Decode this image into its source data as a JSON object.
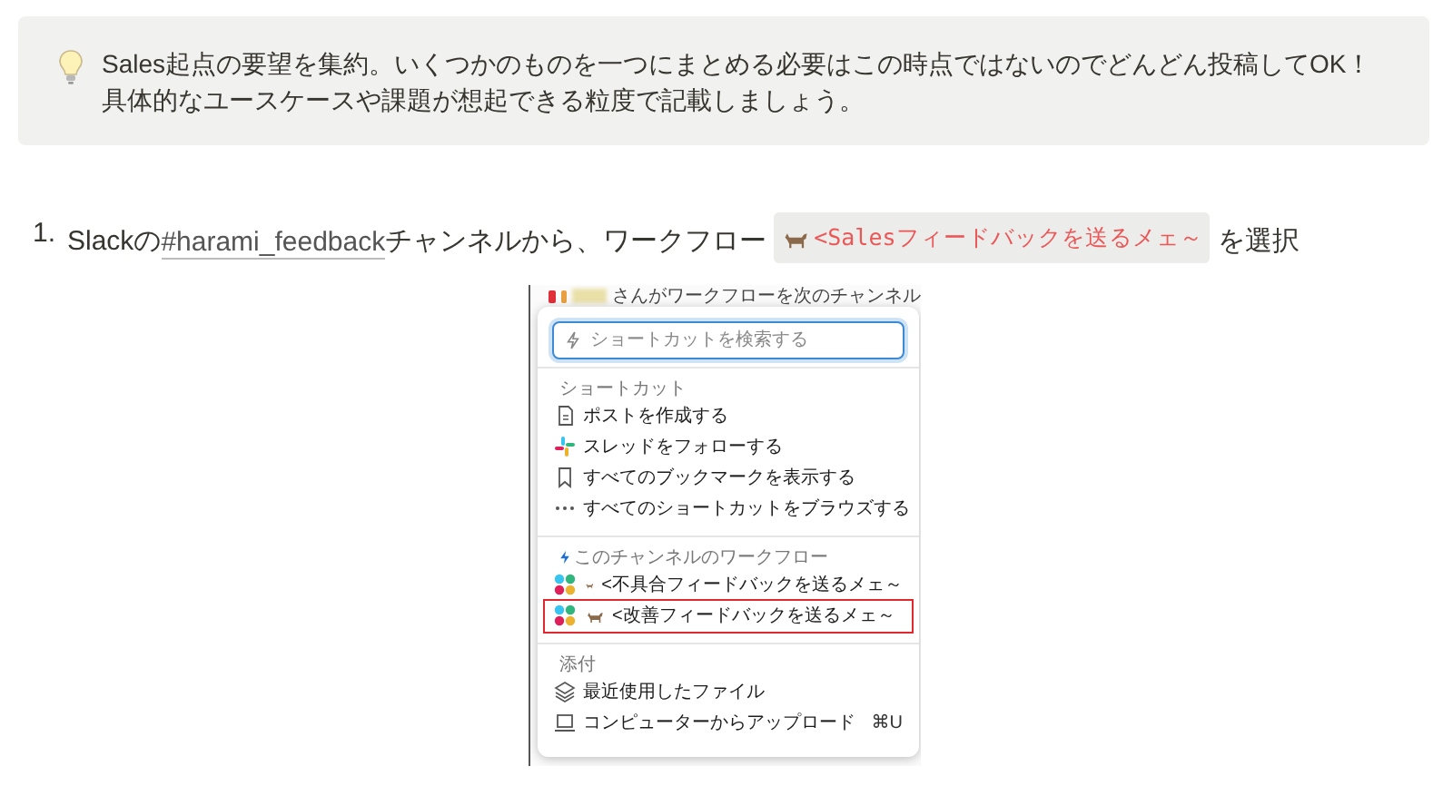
{
  "callout": {
    "lines": [
      "Sales起点の要望を集約。いくつかのものを一つにまとめる必要はこの時点ではないのでどんどん投稿してOK！",
      "具体的なユースケースや課題が想起できる粒度で記載しましょう。"
    ]
  },
  "steps": [
    {
      "number": "1.",
      "before": "Slackの",
      "link": "#harami_feedback",
      "middle": "チャンネルから、ワークフロー",
      "code": "<Salesフィードバックを送るメェ～",
      "after": "を選択"
    }
  ],
  "screenshot": {
    "background_text": "さんがワークフローを次のチャンネル",
    "search": {
      "placeholder": "ショートカットを検索する"
    },
    "sections": [
      {
        "kind": "shortcuts",
        "header": "ショートカット",
        "items": [
          {
            "kind": "document",
            "label": "ポストを作成する",
            "highlighted": false
          },
          {
            "kind": "thread",
            "label": "スレッドをフォローする",
            "highlighted": false
          },
          {
            "kind": "bookmark",
            "label": "すべてのブックマークを表示する",
            "highlighted": false
          },
          {
            "kind": "more",
            "label": "すべてのショートカットをブラウズする",
            "highlighted": false
          }
        ]
      },
      {
        "kind": "workflows",
        "header": "このチャンネルのワークフロー",
        "items": [
          {
            "kind": "workflow",
            "label": "<不具合フィードバックを送るメェ～",
            "highlighted": false
          },
          {
            "kind": "workflow",
            "label": "<改善フィードバックを送るメェ～",
            "highlighted": true
          }
        ]
      },
      {
        "kind": "attachments",
        "header": "添付",
        "items": [
          {
            "kind": "files",
            "label": "最近使用したファイル",
            "highlighted": false
          },
          {
            "kind": "upload",
            "label": "コンピューターからアップロード",
            "shortcut": "⌘U",
            "highlighted": false
          }
        ]
      }
    ]
  }
}
